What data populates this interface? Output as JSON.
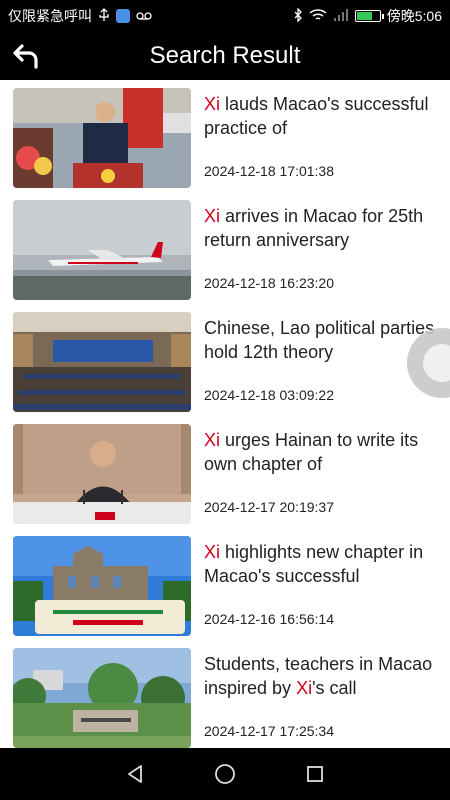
{
  "status_bar": {
    "notifications_text": "仅限紧急呼叫",
    "time": "傍晚5:06",
    "battery_level": 0.7
  },
  "header": {
    "title": "Search Result"
  },
  "results": [
    {
      "keyword": "Xi",
      "rest": " lauds Macao's successful practice of",
      "date": "2024-12-18 17:01:38"
    },
    {
      "keyword": "Xi",
      "rest": " arrives in Macao for 25th return anniversary",
      "date": "2024-12-18 16:23:20"
    },
    {
      "keyword": "",
      "rest": "Chinese, Lao political parties hold 12th theory",
      "date": "2024-12-18 03:09:22"
    },
    {
      "keyword": "Xi",
      "rest": " urges Hainan to write its own chapter of",
      "date": "2024-12-17 20:19:37"
    },
    {
      "keyword": "Xi",
      "rest": " highlights new chapter in Macao's successful",
      "date": "2024-12-16 16:56:14"
    },
    {
      "pre": "Students, teachers in Macao inspired by ",
      "keyword": "Xi",
      "rest": "'s call",
      "date": "2024-12-17 17:25:34"
    }
  ],
  "colors": {
    "highlight": "#d0021b",
    "background": "#ffffff",
    "bar": "#000000"
  }
}
